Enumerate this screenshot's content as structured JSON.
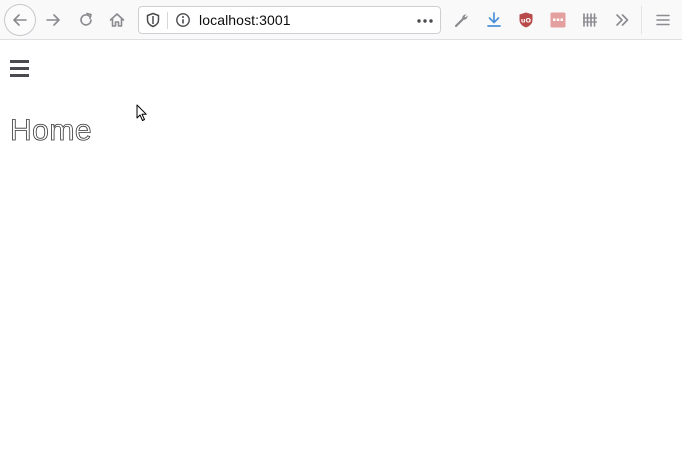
{
  "browser": {
    "url": "localhost:3001",
    "icons": {
      "back": "back-arrow-icon",
      "forward": "forward-arrow-icon",
      "reload": "reload-icon",
      "home": "home-icon",
      "tracking": "shield-icon",
      "site_info": "info-icon",
      "page_actions": "more-dots-icon",
      "tools": "wrench-icon",
      "downloads": "download-arrow-icon",
      "ublock": "ublock-origin-icon",
      "extension": "red-extension-icon",
      "library": "library-icon",
      "overflow": "double-chevron-icon",
      "menu": "menu-icon"
    },
    "colors": {
      "download_accent": "#4a90d9",
      "ublock": "#b84a4a",
      "extension": "#e3a09f"
    }
  },
  "page": {
    "title": "Home",
    "menu_icon": "hamburger-menu-icon"
  }
}
